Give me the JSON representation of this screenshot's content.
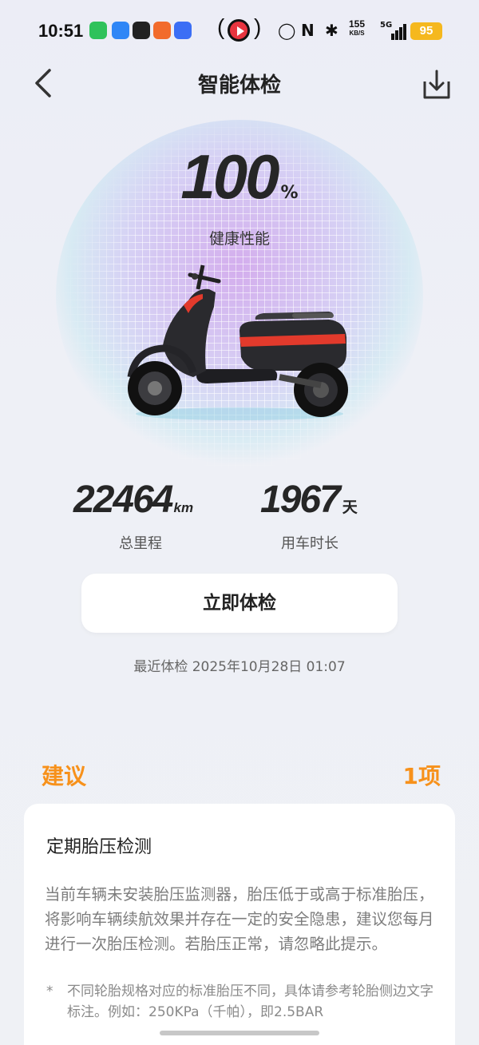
{
  "status_bar": {
    "time": "10:51",
    "net_speed": "155",
    "net_unit": "KB/S",
    "signal": "5G",
    "battery": "95",
    "colors": {
      "wechat": "#2fc25b",
      "app2": "#2f86f6",
      "app3": "#222222",
      "app4": "#f26b2c",
      "app5": "#3b6ef5",
      "battery": "#f5b81e",
      "record": "#e8343f"
    }
  },
  "header": {
    "title": "智能体检",
    "back_icon": "chevron-left-icon",
    "action_icon": "download-icon"
  },
  "hero": {
    "score": "100",
    "score_unit": "%",
    "score_label": "健康性能",
    "image": "electric-scooter"
  },
  "stats": {
    "mileage_value": "22464",
    "mileage_unit": "km",
    "mileage_label": "总里程",
    "days_value": "1967",
    "days_unit": "天",
    "days_label": "用车时长"
  },
  "actions": {
    "check_now": "立即体检",
    "last_check": "最近体检 2025年10月28日 01:07"
  },
  "suggestions": {
    "title": "建议",
    "count": "1项",
    "accent_color": "#f7911b",
    "items": [
      {
        "title": "定期胎压检测",
        "body": "当前车辆未安装胎压监测器，胎压低于或高于标准胎压，将影响车辆续航效果并存在一定的安全隐患，建议您每月进行一次胎压检测。若胎压正常，请忽略此提示。",
        "note_marker": "*",
        "note": "不同轮胎规格对应的标准胎压不同，具体请参考轮胎侧边文字标注。例如：250KPa（千帕），即2.5BAR"
      }
    ]
  }
}
